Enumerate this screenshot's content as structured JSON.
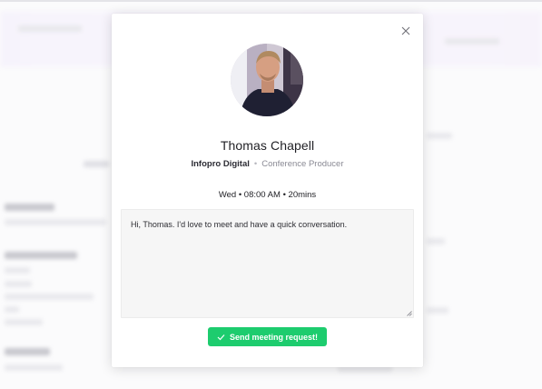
{
  "modal": {
    "profile": {
      "name": "Thomas Chapell",
      "company": "Infopro Digital",
      "separator": "•",
      "role": "Conference Producer"
    },
    "schedule": "Wed • 08:00 AM • 20mins",
    "message": "Hi, Thomas. I'd love to meet and have a quick conversation.",
    "send_label": "Send meeting request!",
    "icons": {
      "close": "close-icon",
      "send": "checkmark-icon"
    },
    "colors": {
      "send_button": "#1dcc6e",
      "message_bg": "#f6f6f6"
    }
  }
}
